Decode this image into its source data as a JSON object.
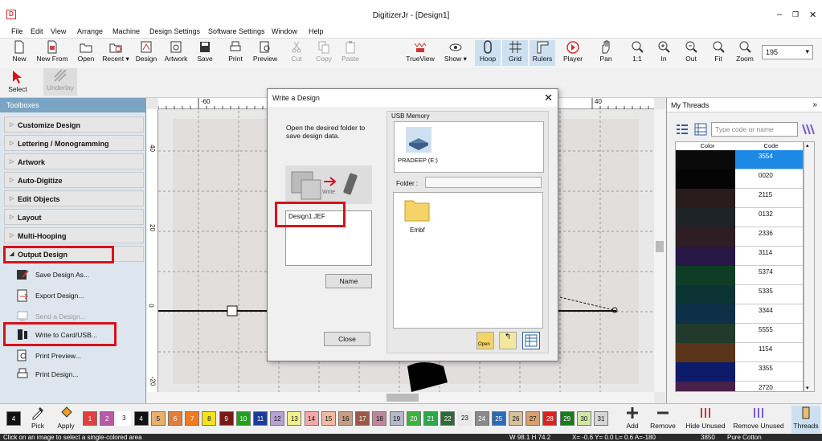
{
  "window": {
    "title": "DigitizerJr - [Design1]",
    "app_icon": "D"
  },
  "menu": [
    "File",
    "Edit",
    "View",
    "Arrange",
    "Machine",
    "Design Settings",
    "Software Settings",
    "Window",
    "Help"
  ],
  "toolbar": [
    {
      "label": "New",
      "icon": "new-icon"
    },
    {
      "label": "New From",
      "icon": "new-from-icon"
    },
    {
      "label": "Open",
      "icon": "open-icon"
    },
    {
      "label": "Recent ▾",
      "icon": "recent-icon"
    },
    {
      "label": "Design",
      "icon": "design-icon"
    },
    {
      "label": "Artwork",
      "icon": "artwork-icon"
    },
    {
      "label": "Save",
      "icon": "save-icon"
    },
    {
      "label": "Print",
      "icon": "print-icon"
    },
    {
      "label": "Preview",
      "icon": "preview-icon"
    },
    {
      "label": "Cut",
      "icon": "cut-icon",
      "disabled": true
    },
    {
      "label": "Copy",
      "icon": "copy-icon",
      "disabled": true
    },
    {
      "label": "Paste",
      "icon": "paste-icon",
      "disabled": true
    },
    {
      "label": "TrueView",
      "icon": "trueview-icon"
    },
    {
      "label": "Show ▾",
      "icon": "show-icon"
    },
    {
      "label": "Hoop",
      "icon": "hoop-icon",
      "active": true
    },
    {
      "label": "Grid",
      "icon": "grid-icon",
      "active": true
    },
    {
      "label": "Rulers",
      "icon": "rulers-icon",
      "active": true
    },
    {
      "label": "Player",
      "icon": "player-icon"
    },
    {
      "label": "Pan",
      "icon": "pan-icon"
    },
    {
      "label": "1:1",
      "icon": "zoom-1to1-icon"
    },
    {
      "label": "In",
      "icon": "zoom-in-icon"
    },
    {
      "label": "Out",
      "icon": "zoom-out-icon"
    },
    {
      "label": "Fit",
      "icon": "zoom-fit-icon"
    },
    {
      "label": "Zoom",
      "icon": "zoom-icon"
    }
  ],
  "zoom_value": "195",
  "toolbar2": [
    {
      "label": "Select",
      "icon": "select-arrow-icon"
    },
    {
      "label": "Underlay",
      "icon": "underlay-icon",
      "disabled": true
    }
  ],
  "toolboxes": {
    "header": "Toolboxes",
    "categories": [
      "Customize Design",
      "Lettering / Monogramming",
      "Artwork",
      "Auto-Digitize",
      "Edit Objects",
      "Layout",
      "Multi-Hooping",
      "Output Design"
    ],
    "output_items": [
      {
        "label": "Save Design As...",
        "disabled": false
      },
      {
        "label": "Export Design...",
        "disabled": false
      },
      {
        "label": "Send a Design...",
        "disabled": true
      },
      {
        "label": "Write to Card/USB...",
        "disabled": false
      },
      {
        "label": "Print Preview...",
        "disabled": false
      },
      {
        "label": "Print Design...",
        "disabled": false
      }
    ]
  },
  "rulers": {
    "top": [
      "-60",
      "40"
    ],
    "left": [
      "40",
      "20",
      "0",
      "-20"
    ]
  },
  "dialog": {
    "title": "Write a Design",
    "instruction": "Open the desired folder to save design data.",
    "graphic_label": "Write",
    "file": "Design1.JEF",
    "name_button": "Name",
    "close_button": "Close",
    "usb_label": "USB Memory",
    "usb_drive": "PRADEEP (E:)",
    "folder_label": "Folder :",
    "folder_value": "",
    "folder_item": "Embf",
    "open_label": "Open"
  },
  "threads": {
    "header": "My Threads",
    "search_placeholder": "Type code or name",
    "col_color": "Color",
    "col_code": "Code",
    "rows": [
      {
        "code": "3554",
        "color": "#0a0a0a",
        "selected": true
      },
      {
        "code": "0020",
        "color": "#050505"
      },
      {
        "code": "2115",
        "color": "#2a1c1e"
      },
      {
        "code": "0132",
        "color": "#1d2326"
      },
      {
        "code": "2336",
        "color": "#2e1d22"
      },
      {
        "code": "3114",
        "color": "#261744"
      },
      {
        "code": "5374",
        "color": "#0e3d26"
      },
      {
        "code": "5335",
        "color": "#0c3435"
      },
      {
        "code": "3344",
        "color": "#0e2f48"
      },
      {
        "code": "5555",
        "color": "#213a2b"
      },
      {
        "code": "1154",
        "color": "#5a3419"
      },
      {
        "code": "3355",
        "color": "#0c1c6a"
      },
      {
        "code": "2720",
        "color": "#4a1f4a"
      }
    ]
  },
  "palette": [
    {
      "n": "4",
      "c": "#111111"
    },
    {
      "n": "1",
      "c": "#e04040"
    },
    {
      "n": "2",
      "c": "#b85aa6"
    },
    {
      "n": "3",
      "c": "#ffffff"
    },
    {
      "n": "4",
      "c": "#111111"
    },
    {
      "n": "5",
      "c": "#e8b06b"
    },
    {
      "n": "6",
      "c": "#e27e3c"
    },
    {
      "n": "7",
      "c": "#f07a20"
    },
    {
      "n": "8",
      "c": "#f4e21c"
    },
    {
      "n": "9",
      "c": "#7a1a14"
    },
    {
      "n": "10",
      "c": "#20a020"
    },
    {
      "n": "11",
      "c": "#1c3c9c"
    },
    {
      "n": "12",
      "c": "#b7a0d6"
    },
    {
      "n": "13",
      "c": "#f3ef8e"
    },
    {
      "n": "14",
      "c": "#f6a7a7"
    },
    {
      "n": "15",
      "c": "#f3b8a2"
    },
    {
      "n": "16",
      "c": "#c79d83"
    },
    {
      "n": "17",
      "c": "#9a5a4a"
    },
    {
      "n": "18",
      "c": "#c0879a"
    },
    {
      "n": "19",
      "c": "#b4b8c8"
    },
    {
      "n": "20",
      "c": "#3cb43c"
    },
    {
      "n": "21",
      "c": "#2aa84a"
    },
    {
      "n": "22",
      "c": "#2e6a3a"
    },
    {
      "n": "23",
      "c": "#e8e8e8"
    },
    {
      "n": "24",
      "c": "#8a8a8a"
    },
    {
      "n": "25",
      "c": "#2f6ab4"
    },
    {
      "n": "26",
      "c": "#d8c09a"
    },
    {
      "n": "27",
      "c": "#d8a070"
    },
    {
      "n": "28",
      "c": "#e02020"
    },
    {
      "n": "29",
      "c": "#1a7a1a"
    },
    {
      "n": "30",
      "c": "#cfe6a8"
    },
    {
      "n": "31",
      "c": "#d6d6d6"
    }
  ],
  "palette_buttons": [
    {
      "label": "Pick",
      "icon": "eyedropper-icon"
    },
    {
      "label": "Apply",
      "icon": "paint-bucket-icon"
    },
    {
      "label": "Add",
      "icon": "add-icon"
    },
    {
      "label": "Remove",
      "icon": "remove-icon"
    },
    {
      "label": "Hide Unused",
      "icon": "hide-unused-icon"
    },
    {
      "label": "Remove Unused",
      "icon": "remove-unused-icon"
    },
    {
      "label": "Threads",
      "icon": "threads-icon"
    }
  ],
  "status": {
    "hint": "Click on an image to select a single-colored area",
    "dims": "W 98.1 H 74.2",
    "coords": "X= -0.6 Y= 0.0 L= 0.6 A=-180",
    "thread": "3850",
    "brand": "Pure Cotton"
  }
}
